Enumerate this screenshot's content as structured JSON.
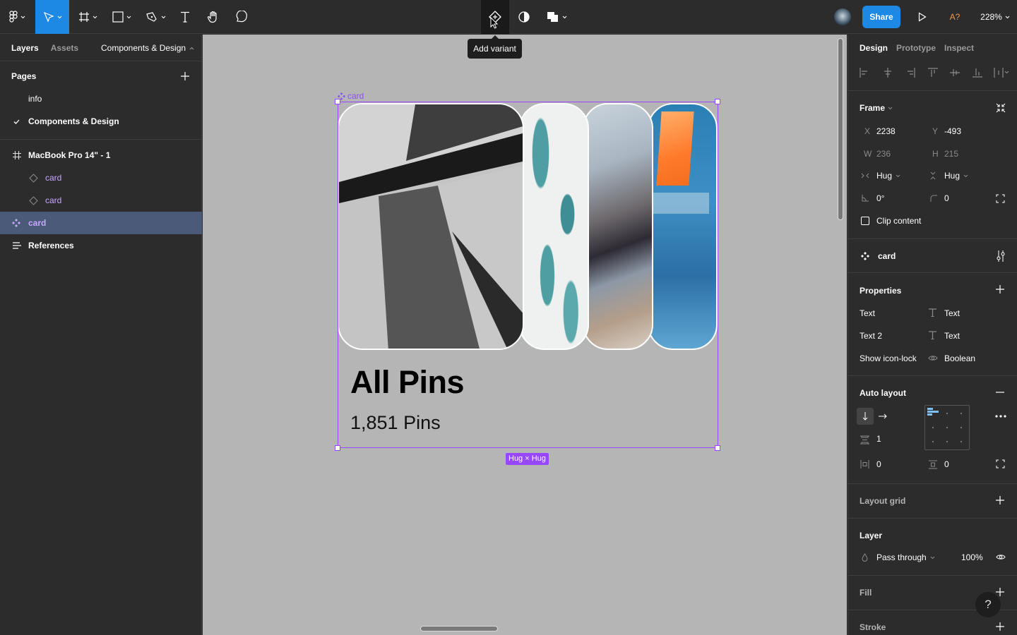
{
  "toolbar": {
    "tools": [
      "main-menu",
      "move",
      "frame",
      "shape",
      "pen",
      "text",
      "hand",
      "comment"
    ],
    "center_tools": [
      "add-variant",
      "mask",
      "boolean-ops"
    ],
    "tooltip": "Add variant",
    "share_label": "Share",
    "missing_fonts_label": "A?",
    "zoom_level": "228%",
    "accent_color": "#1e88e5"
  },
  "left_panel": {
    "tabs": {
      "layers": "Layers",
      "assets": "Assets"
    },
    "page_selector": "Components & Design",
    "pages_title": "Pages",
    "pages": [
      {
        "label": "info",
        "current": false
      },
      {
        "label": "Components & Design",
        "current": true
      }
    ],
    "layers": [
      {
        "label": "MacBook Pro 14\" - 1",
        "type": "frame"
      },
      {
        "label": "card",
        "type": "instance"
      },
      {
        "label": "card",
        "type": "instance"
      },
      {
        "label": "card",
        "type": "component",
        "selected": true
      },
      {
        "label": "References",
        "type": "text"
      }
    ]
  },
  "canvas": {
    "component_label": "card",
    "card_title": "All Pins",
    "card_subtitle": "1,851 Pins",
    "size_badge": "Hug × Hug",
    "selection_color": "#9747ff"
  },
  "right_panel": {
    "tabs": {
      "design": "Design",
      "prototype": "Prototype",
      "inspect": "Inspect"
    },
    "frame": {
      "title": "Frame",
      "x_label": "X",
      "x": "2238",
      "y_label": "Y",
      "y": "-493",
      "w_label": "W",
      "w": "236",
      "h_label": "H",
      "h": "215",
      "h_resize": "Hug",
      "v_resize": "Hug",
      "rotation": "0°",
      "radius": "0",
      "clip_content_label": "Clip content",
      "clip_content": false
    },
    "component": {
      "name": "card"
    },
    "properties": {
      "title": "Properties",
      "items": [
        {
          "name": "Text",
          "type": "Text"
        },
        {
          "name": "Text 2",
          "type": "Text"
        },
        {
          "name": "Show icon-lock",
          "type": "Boolean"
        }
      ]
    },
    "auto_layout": {
      "title": "Auto layout",
      "direction": "vertical",
      "spacing": "1",
      "h_padding": "0",
      "v_padding": "0"
    },
    "layout_grid": {
      "title": "Layout grid"
    },
    "layer": {
      "title": "Layer",
      "blend": "Pass through",
      "opacity": "100%"
    },
    "fill": {
      "title": "Fill"
    },
    "stroke": {
      "title": "Stroke"
    },
    "help_label": "?"
  }
}
